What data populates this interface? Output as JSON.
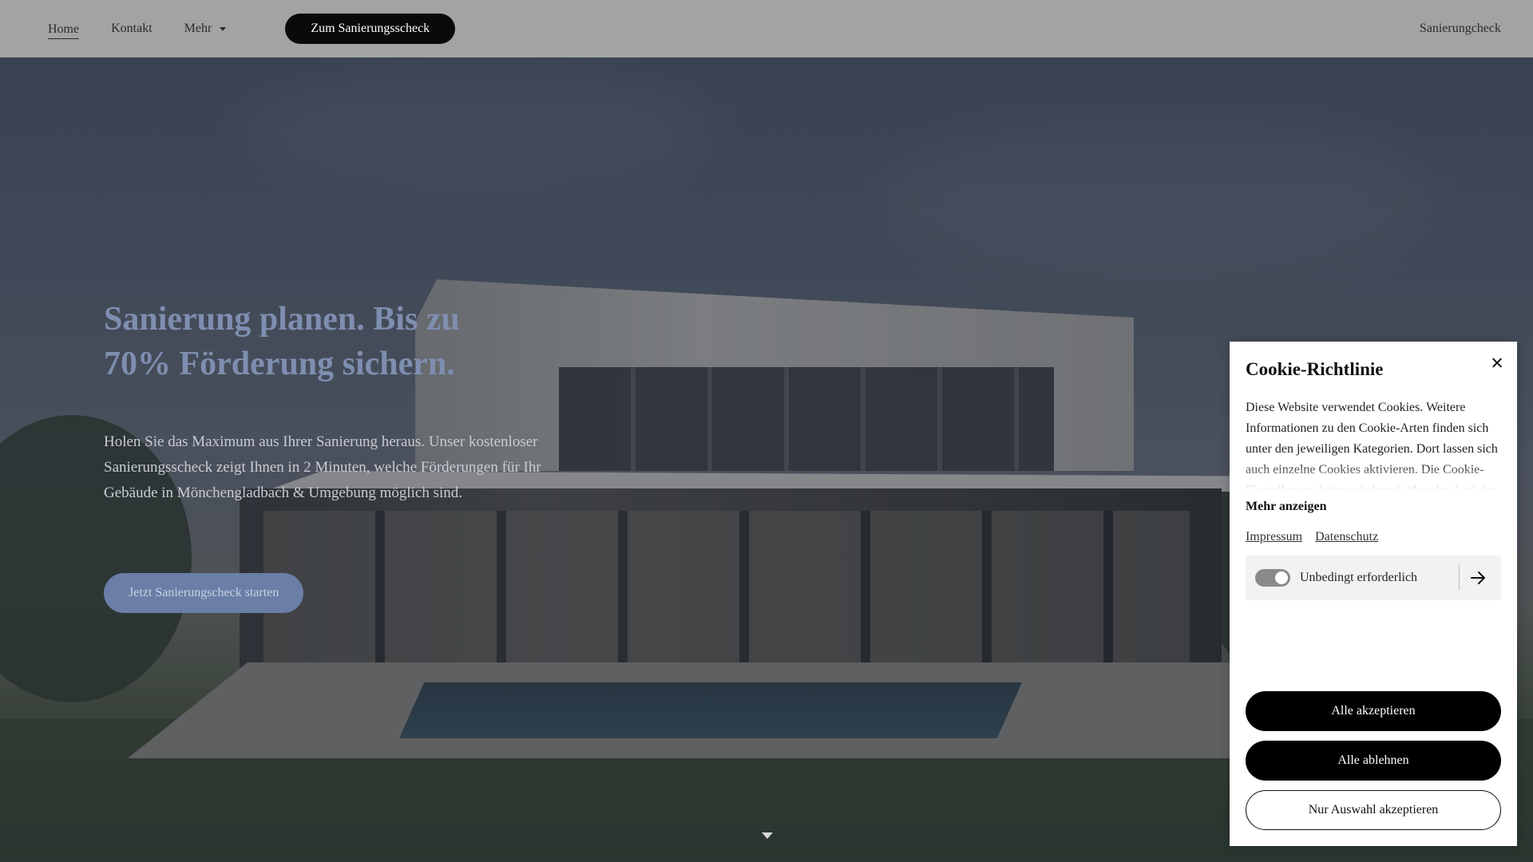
{
  "header": {
    "nav": [
      {
        "label": "Home"
      },
      {
        "label": "Kontakt"
      },
      {
        "label": "Mehr"
      }
    ],
    "cta_label": "Zum Sanierungsscheck",
    "right_link": "Sanierungcheck"
  },
  "hero": {
    "title_line1": "Sanierung planen. Bis zu",
    "title_line2": "70% Förderung sichern.",
    "text": "Holen Sie das Maximum aus Ihrer Sanierung heraus. Unser kostenloser Sanierungsscheck zeigt Ihnen in 2 Minuten, welche Förderungen für Ihr Gebäude in Mönchengladbach & Umgebung möglich sind.",
    "button_label": "Jetzt Sanierungscheck starten"
  },
  "cookie": {
    "title": "Cookie-Richtlinie",
    "text": "Diese Website verwendet Cookies. Weitere Informationen zu den Cookie-Arten finden sich unter den jeweiligen Kategorien. Dort lassen sich auch einzelne Cookies aktivieren. Die Cookie-Einstellungen können jederzeit über den Link im",
    "more_label": "Mehr anzeigen",
    "links": [
      "Impressum",
      "Datenschutz"
    ],
    "category": {
      "label": "Unbedingt erforderlich",
      "enabled": true
    },
    "buttons": {
      "accept_all": "Alle akzeptieren",
      "reject_all": "Alle ablehnen",
      "accept_selection": "Nur Auswahl akzeptieren"
    }
  },
  "icons": {
    "close": "close-icon",
    "category_arrow": "arrow-right-icon",
    "dropdown": "chevron-down-icon",
    "scroll": "chevron-down-icon"
  }
}
